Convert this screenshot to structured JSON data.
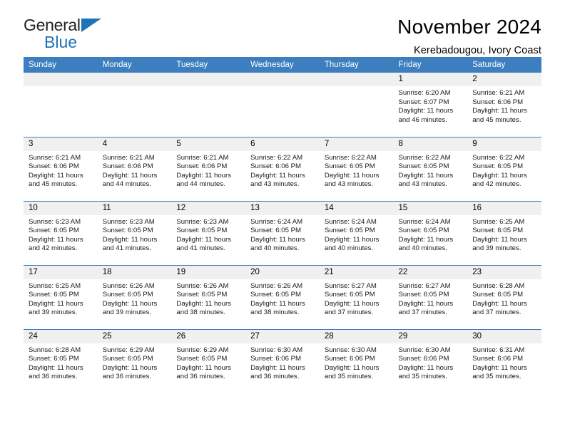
{
  "brand": {
    "name_part1": "General",
    "name_part2": "Blue"
  },
  "header": {
    "title": "November 2024",
    "subtitle": "Kerebadougou, Ivory Coast"
  },
  "theme": {
    "header_blue": "#3d7ebf",
    "logo_blue": "#1f72b8",
    "daynum_bg": "#f0f0f0"
  },
  "labels": {
    "sunrise_prefix": "Sunrise:",
    "sunset_prefix": "Sunset:",
    "daylight_prefix": "Daylight:"
  },
  "weekdays": [
    "Sunday",
    "Monday",
    "Tuesday",
    "Wednesday",
    "Thursday",
    "Friday",
    "Saturday"
  ],
  "weeks": [
    [
      {
        "day": "",
        "blank": true
      },
      {
        "day": "",
        "blank": true
      },
      {
        "day": "",
        "blank": true
      },
      {
        "day": "",
        "blank": true
      },
      {
        "day": "",
        "blank": true
      },
      {
        "day": "1",
        "sunrise": "Sunrise: 6:20 AM",
        "sunset": "Sunset: 6:07 PM",
        "daylight": "Daylight: 11 hours and 46 minutes."
      },
      {
        "day": "2",
        "sunrise": "Sunrise: 6:21 AM",
        "sunset": "Sunset: 6:06 PM",
        "daylight": "Daylight: 11 hours and 45 minutes."
      }
    ],
    [
      {
        "day": "3",
        "sunrise": "Sunrise: 6:21 AM",
        "sunset": "Sunset: 6:06 PM",
        "daylight": "Daylight: 11 hours and 45 minutes."
      },
      {
        "day": "4",
        "sunrise": "Sunrise: 6:21 AM",
        "sunset": "Sunset: 6:06 PM",
        "daylight": "Daylight: 11 hours and 44 minutes."
      },
      {
        "day": "5",
        "sunrise": "Sunrise: 6:21 AM",
        "sunset": "Sunset: 6:06 PM",
        "daylight": "Daylight: 11 hours and 44 minutes."
      },
      {
        "day": "6",
        "sunrise": "Sunrise: 6:22 AM",
        "sunset": "Sunset: 6:06 PM",
        "daylight": "Daylight: 11 hours and 43 minutes."
      },
      {
        "day": "7",
        "sunrise": "Sunrise: 6:22 AM",
        "sunset": "Sunset: 6:05 PM",
        "daylight": "Daylight: 11 hours and 43 minutes."
      },
      {
        "day": "8",
        "sunrise": "Sunrise: 6:22 AM",
        "sunset": "Sunset: 6:05 PM",
        "daylight": "Daylight: 11 hours and 43 minutes."
      },
      {
        "day": "9",
        "sunrise": "Sunrise: 6:22 AM",
        "sunset": "Sunset: 6:05 PM",
        "daylight": "Daylight: 11 hours and 42 minutes."
      }
    ],
    [
      {
        "day": "10",
        "sunrise": "Sunrise: 6:23 AM",
        "sunset": "Sunset: 6:05 PM",
        "daylight": "Daylight: 11 hours and 42 minutes."
      },
      {
        "day": "11",
        "sunrise": "Sunrise: 6:23 AM",
        "sunset": "Sunset: 6:05 PM",
        "daylight": "Daylight: 11 hours and 41 minutes."
      },
      {
        "day": "12",
        "sunrise": "Sunrise: 6:23 AM",
        "sunset": "Sunset: 6:05 PM",
        "daylight": "Daylight: 11 hours and 41 minutes."
      },
      {
        "day": "13",
        "sunrise": "Sunrise: 6:24 AM",
        "sunset": "Sunset: 6:05 PM",
        "daylight": "Daylight: 11 hours and 40 minutes."
      },
      {
        "day": "14",
        "sunrise": "Sunrise: 6:24 AM",
        "sunset": "Sunset: 6:05 PM",
        "daylight": "Daylight: 11 hours and 40 minutes."
      },
      {
        "day": "15",
        "sunrise": "Sunrise: 6:24 AM",
        "sunset": "Sunset: 6:05 PM",
        "daylight": "Daylight: 11 hours and 40 minutes."
      },
      {
        "day": "16",
        "sunrise": "Sunrise: 6:25 AM",
        "sunset": "Sunset: 6:05 PM",
        "daylight": "Daylight: 11 hours and 39 minutes."
      }
    ],
    [
      {
        "day": "17",
        "sunrise": "Sunrise: 6:25 AM",
        "sunset": "Sunset: 6:05 PM",
        "daylight": "Daylight: 11 hours and 39 minutes."
      },
      {
        "day": "18",
        "sunrise": "Sunrise: 6:26 AM",
        "sunset": "Sunset: 6:05 PM",
        "daylight": "Daylight: 11 hours and 39 minutes."
      },
      {
        "day": "19",
        "sunrise": "Sunrise: 6:26 AM",
        "sunset": "Sunset: 6:05 PM",
        "daylight": "Daylight: 11 hours and 38 minutes."
      },
      {
        "day": "20",
        "sunrise": "Sunrise: 6:26 AM",
        "sunset": "Sunset: 6:05 PM",
        "daylight": "Daylight: 11 hours and 38 minutes."
      },
      {
        "day": "21",
        "sunrise": "Sunrise: 6:27 AM",
        "sunset": "Sunset: 6:05 PM",
        "daylight": "Daylight: 11 hours and 37 minutes."
      },
      {
        "day": "22",
        "sunrise": "Sunrise: 6:27 AM",
        "sunset": "Sunset: 6:05 PM",
        "daylight": "Daylight: 11 hours and 37 minutes."
      },
      {
        "day": "23",
        "sunrise": "Sunrise: 6:28 AM",
        "sunset": "Sunset: 6:05 PM",
        "daylight": "Daylight: 11 hours and 37 minutes."
      }
    ],
    [
      {
        "day": "24",
        "sunrise": "Sunrise: 6:28 AM",
        "sunset": "Sunset: 6:05 PM",
        "daylight": "Daylight: 11 hours and 36 minutes."
      },
      {
        "day": "25",
        "sunrise": "Sunrise: 6:29 AM",
        "sunset": "Sunset: 6:05 PM",
        "daylight": "Daylight: 11 hours and 36 minutes."
      },
      {
        "day": "26",
        "sunrise": "Sunrise: 6:29 AM",
        "sunset": "Sunset: 6:05 PM",
        "daylight": "Daylight: 11 hours and 36 minutes."
      },
      {
        "day": "27",
        "sunrise": "Sunrise: 6:30 AM",
        "sunset": "Sunset: 6:06 PM",
        "daylight": "Daylight: 11 hours and 36 minutes."
      },
      {
        "day": "28",
        "sunrise": "Sunrise: 6:30 AM",
        "sunset": "Sunset: 6:06 PM",
        "daylight": "Daylight: 11 hours and 35 minutes."
      },
      {
        "day": "29",
        "sunrise": "Sunrise: 6:30 AM",
        "sunset": "Sunset: 6:06 PM",
        "daylight": "Daylight: 11 hours and 35 minutes."
      },
      {
        "day": "30",
        "sunrise": "Sunrise: 6:31 AM",
        "sunset": "Sunset: 6:06 PM",
        "daylight": "Daylight: 11 hours and 35 minutes."
      }
    ]
  ]
}
